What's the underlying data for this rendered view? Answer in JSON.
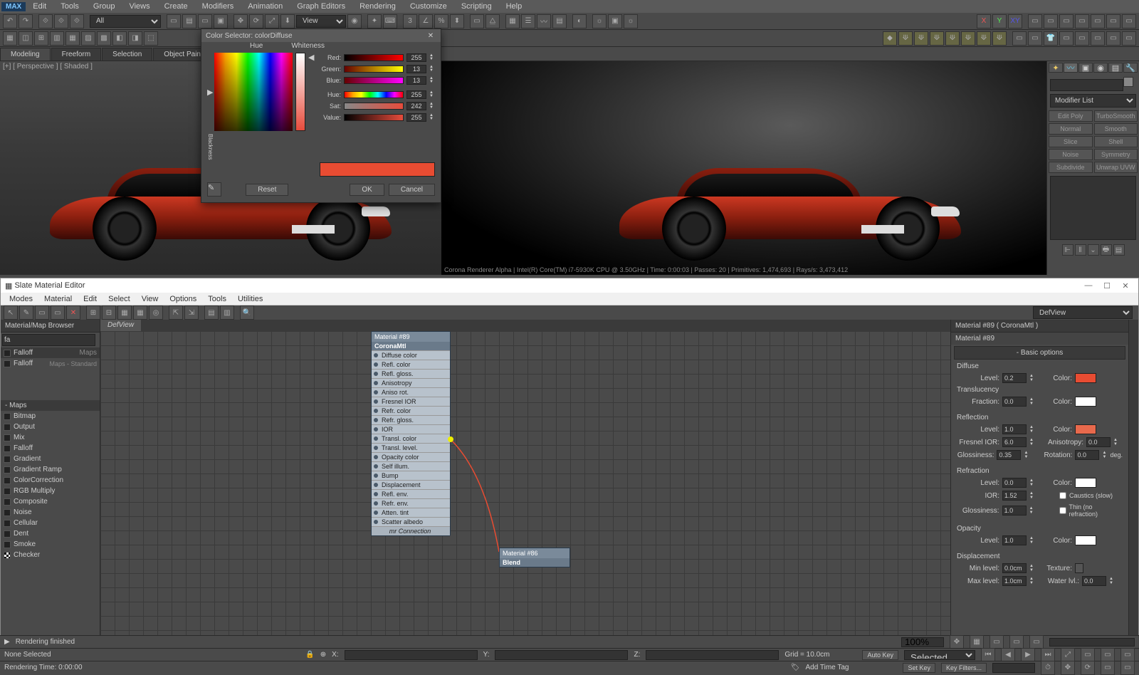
{
  "app": {
    "logo": "MAX"
  },
  "menu": [
    "Edit",
    "Tools",
    "Group",
    "Views",
    "Create",
    "Modifiers",
    "Animation",
    "Graph Editors",
    "Rendering",
    "Customize",
    "Scripting",
    "Help"
  ],
  "toolbar": {
    "selection_filter": "All",
    "view_dropdown": "View"
  },
  "ribbon_tabs": [
    "Modeling",
    "Freeform",
    "Selection",
    "Object Paint"
  ],
  "viewport": {
    "label": "[+] [ Perspective ] [ Shaded ]",
    "render_status": "Corona Renderer Alpha | Intel(R) Core(TM) i7-5930K CPU @ 3.50GHz | Time: 0:00:03 | Passes: 20 | Primitives: 1,474,693 | Rays/s: 3,473,412"
  },
  "command_panel": {
    "modifier_list": "Modifier List",
    "mods": [
      "Edit Poly",
      "TurboSmooth",
      "Normal",
      "Smooth",
      "Slice",
      "Shell",
      "Noise",
      "Symmetry",
      "Subdivide",
      "Unwrap UVW"
    ]
  },
  "color_selector": {
    "title": "Color Selector: colorDiffuse",
    "hue_label": "Hue",
    "whiteness_label": "Whiteness",
    "blackness_label": "Blackness",
    "red_label": "Red:",
    "green_label": "Green:",
    "blue_label": "Blue:",
    "hue_field_label": "Hue:",
    "sat_label": "Sat:",
    "value_label": "Value:",
    "red": "255",
    "green": "13",
    "blue": "13",
    "hue": "255",
    "sat": "242",
    "value": "255",
    "reset": "Reset",
    "ok": "OK",
    "cancel": "Cancel"
  },
  "slate": {
    "title": "Slate Material Editor",
    "menu": [
      "Modes",
      "Material",
      "Edit",
      "Select",
      "View",
      "Options",
      "Tools",
      "Utilities"
    ],
    "browser_header": "Material/Map Browser",
    "search": "fa",
    "search_results": [
      {
        "name": "Falloff",
        "cat": "Maps"
      },
      {
        "name": "Falloff",
        "cat": "Maps - Standard"
      }
    ],
    "maps_header": "- Maps",
    "maps": [
      "Bitmap",
      "Output",
      "Mix",
      "Falloff",
      "Gradient",
      "Gradient Ramp",
      "ColorCorrection",
      "RGB Multiply",
      "Composite",
      "Noise",
      "Cellular",
      "Dent",
      "Smoke",
      "Checker"
    ],
    "view_tab": "DefView",
    "view_dropdown": "DefView",
    "node1": {
      "title": "Material #89",
      "type": "CoronaMtl",
      "slots": [
        "Diffuse color",
        "Refl. color",
        "Refl. gloss.",
        "Anisotropy",
        "Aniso rot.",
        "Fresnel IOR",
        "Refr. color",
        "Refr. gloss.",
        "IOR",
        "Transl. color",
        "Transl. level.",
        "Opacity color",
        "Self illum.",
        "Bump",
        "Displacement",
        "Refl. env.",
        "Refr. env.",
        "Atten. tint",
        "Scatter albedo"
      ],
      "mr": "mr Connection"
    },
    "node2": {
      "title": "Material #86",
      "sub": "Blend"
    },
    "params": {
      "header": "Material #89  ( CoronaMtl )",
      "name": "Material #89",
      "rollout": "Basic options",
      "diffuse_section": "Diffuse",
      "level_label": "Level:",
      "color_label": "Color:",
      "translucency_section": "Translucency",
      "fraction_label": "Fraction:",
      "reflection_section": "Reflection",
      "fresnel_ior_label": "Fresnel IOR:",
      "anisotropy_label": "Anisotropy:",
      "glossiness_label": "Glossiness:",
      "rotation_label": "Rotation:",
      "deg": "deg.",
      "refraction_section": "Refraction",
      "ior_label": "IOR:",
      "caustics_label": "Caustics (slow)",
      "thin_label": "Thin (no refraction)",
      "opacity_section": "Opacity",
      "displacement_section": "Displacement",
      "min_level_label": "Min level:",
      "texture_label": "Texture:",
      "max_level_label": "Max level:",
      "water_lvl_label": "Water lvl.:",
      "diffuse_level": "0.2",
      "diffuse_color": "#e84c32",
      "translucency_fraction": "0.0",
      "translucency_color": "#ffffff",
      "reflection_level": "1.0",
      "reflection_color": "#e8694c",
      "fresnel_ior": "6.0",
      "anisotropy": "0.0",
      "reflection_glossiness": "0.35",
      "rotation": "0.0",
      "refraction_level": "0.0",
      "refraction_color": "#ffffff",
      "refraction_ior": "1.52",
      "refraction_glossiness": "1.0",
      "opacity_level": "1.0",
      "opacity_color": "#ffffff",
      "min_level": "0.0cm",
      "max_level": "1.0cm",
      "water_lvl": "0.0"
    }
  },
  "status": {
    "rendering_msg": "Rendering finished",
    "none_selected": "None Selected",
    "x_label": "X:",
    "y_label": "Y:",
    "z_label": "Z:",
    "grid": "Grid = 10.0cm",
    "autokey": "Auto Key",
    "selected": "Selected",
    "rendering_time": "Rendering Time: 0:00:00",
    "add_time_tag": "Add Time Tag",
    "set_key": "Set Key",
    "key_filters": "Key Filters...",
    "zoom": "100%"
  }
}
